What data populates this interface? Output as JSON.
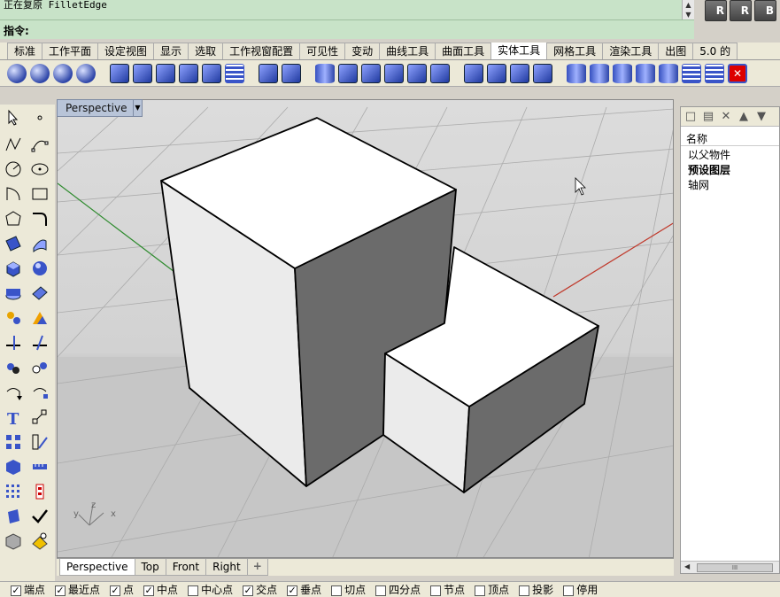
{
  "command": {
    "history_line": "正在复原 FilletEdge",
    "prompt_label": "指令:",
    "input_value": ""
  },
  "render_buttons": [
    "R",
    "R",
    "B"
  ],
  "tabs": [
    {
      "label": "标准",
      "active": false
    },
    {
      "label": "工作平面",
      "active": false
    },
    {
      "label": "设定视图",
      "active": false
    },
    {
      "label": "显示",
      "active": false
    },
    {
      "label": "选取",
      "active": false
    },
    {
      "label": "工作视窗配置",
      "active": false
    },
    {
      "label": "可见性",
      "active": false
    },
    {
      "label": "变动",
      "active": false
    },
    {
      "label": "曲线工具",
      "active": false
    },
    {
      "label": "曲面工具",
      "active": false
    },
    {
      "label": "实体工具",
      "active": true
    },
    {
      "label": "网格工具",
      "active": false
    },
    {
      "label": "渲染工具",
      "active": false
    },
    {
      "label": "出图",
      "active": false
    },
    {
      "label": "5.0 的",
      "active": false
    }
  ],
  "viewport": {
    "title": "Perspective",
    "axis_labels": {
      "x": "x",
      "y": "y",
      "z": "z"
    }
  },
  "viewport_tabs": [
    {
      "label": "Perspective",
      "active": true
    },
    {
      "label": "Top",
      "active": false
    },
    {
      "label": "Front",
      "active": false
    },
    {
      "label": "Right",
      "active": false
    },
    {
      "label": "+",
      "active": false
    }
  ],
  "layers_panel": {
    "header": "名称",
    "items": [
      {
        "label": "以父物件",
        "bold": false
      },
      {
        "label": "预设图层",
        "bold": true
      },
      {
        "label": "轴网",
        "bold": false
      }
    ],
    "scroll_thumb": "III"
  },
  "osnaps": [
    {
      "label": "端点",
      "checked": true
    },
    {
      "label": "最近点",
      "checked": true
    },
    {
      "label": "点",
      "checked": true
    },
    {
      "label": "中点",
      "checked": true
    },
    {
      "label": "中心点",
      "checked": false
    },
    {
      "label": "交点",
      "checked": true
    },
    {
      "label": "垂点",
      "checked": true
    },
    {
      "label": "切点",
      "checked": false
    },
    {
      "label": "四分点",
      "checked": false
    },
    {
      "label": "节点",
      "checked": false
    },
    {
      "label": "顶点",
      "checked": false
    },
    {
      "label": "投影",
      "checked": false
    },
    {
      "label": "停用",
      "checked": false
    }
  ],
  "colors": {
    "command_bg": "#c8e3c8",
    "viewport_bg": "#c8c8c8",
    "x_axis": "#c0392b",
    "y_axis": "#2e8b2e",
    "shade_dark": "#6b6b6b"
  }
}
